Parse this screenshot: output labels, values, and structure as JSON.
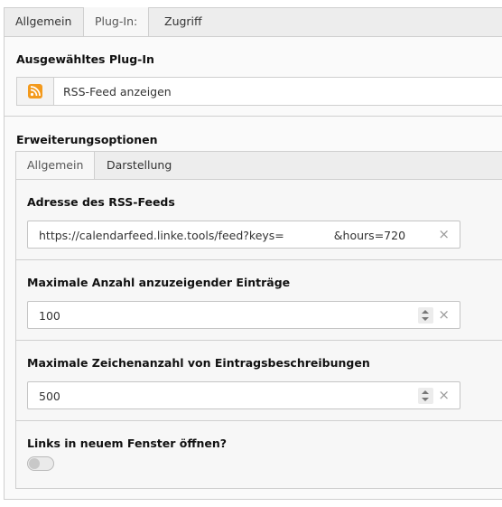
{
  "outer_tabs": [
    {
      "label": "Allgemein",
      "active": false
    },
    {
      "label": "Plug-In:",
      "active": true
    },
    {
      "label": "Zugriff",
      "active": false
    }
  ],
  "plugin": {
    "title": "Ausgewähltes Plug-In",
    "icon": "rss-icon",
    "value": "RSS-Feed anzeigen"
  },
  "extension": {
    "title": "Erweiterungsoptionen",
    "tabs": [
      {
        "label": "Allgemein",
        "active": true
      },
      {
        "label": "Darstellung",
        "active": false
      }
    ]
  },
  "fields": {
    "rss_address": {
      "label": "Adresse des RSS-Feeds",
      "value_part1": "https://calendarfeed.linke.tools/feed?keys=",
      "value_part2": "&hours=720"
    },
    "max_entries": {
      "label": "Maximale Anzahl anzuzeigender Einträge",
      "value": "100"
    },
    "max_chars": {
      "label": "Maximale Zeichenanzahl von Eintragsbeschreibungen",
      "value": "500"
    },
    "new_window": {
      "label": "Links in neuem Fenster öffnen?",
      "checked": false
    }
  },
  "icons": {
    "clear": "×"
  },
  "colors": {
    "rss": "#f39a1d"
  }
}
